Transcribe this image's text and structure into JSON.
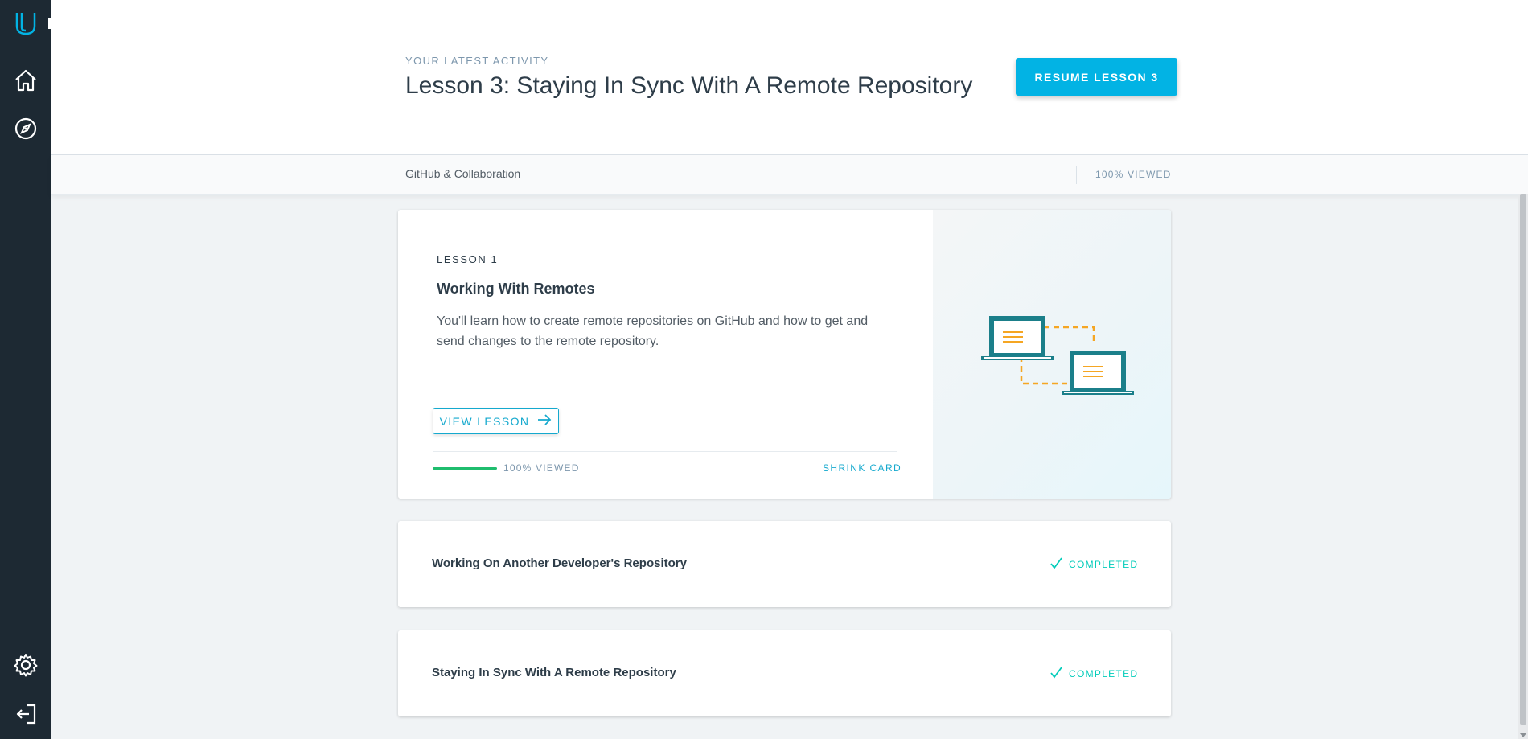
{
  "header": {
    "eyebrow": "YOUR LATEST ACTIVITY",
    "title": "Lesson 3: Staying In Sync With A Remote Repository",
    "resume_label": "RESUME LESSON 3"
  },
  "subbar": {
    "course_name": "GitHub & Collaboration",
    "viewed": "100% VIEWED"
  },
  "lesson_card": {
    "number": "LESSON 1",
    "title": "Working With Remotes",
    "description": "You'll learn how to create remote repositories on GitHub and how to get and send changes to the remote repository.",
    "view_label": "VIEW LESSON",
    "progress_percent": 100,
    "progress_label": "100% VIEWED",
    "shrink_label": "SHRINK CARD"
  },
  "lessons": [
    {
      "title": "Working On Another Developer's Repository",
      "status": "COMPLETED"
    },
    {
      "title": "Staying In Sync With A Remote Repository",
      "status": "COMPLETED"
    }
  ],
  "sidebar": {
    "icons": [
      "udacity-logo-icon",
      "home-icon",
      "compass-icon",
      "gear-icon",
      "logout-icon"
    ]
  },
  "colors": {
    "sidebar_bg": "#1d2933",
    "accent": "#02b3e4",
    "link": "#15a9ce",
    "success": "#02ccba",
    "progress": "#1fbd6e",
    "illustration_teal": "#1b7f8a",
    "illustration_orange": "#f5a623"
  }
}
